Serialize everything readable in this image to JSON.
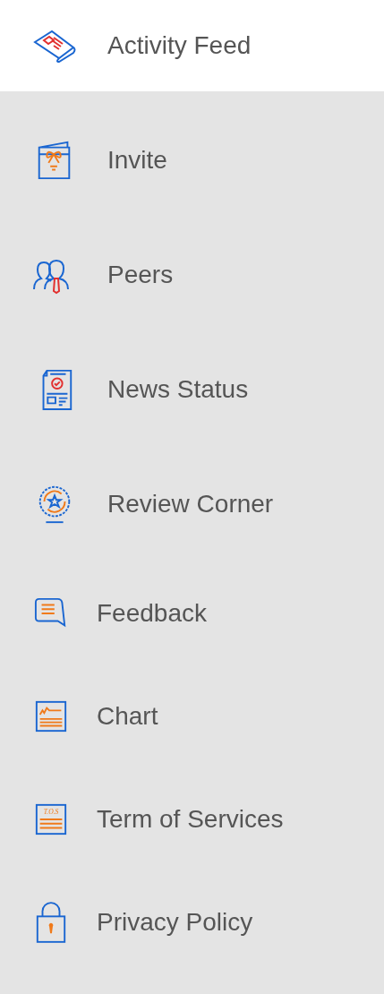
{
  "menu": {
    "items": [
      {
        "label": "Activity Feed",
        "kind": "newspaper",
        "selected": true
      },
      {
        "label": "Invite",
        "kind": "card",
        "selected": false
      },
      {
        "label": "Peers",
        "kind": "people",
        "selected": false
      },
      {
        "label": "News Status",
        "kind": "document",
        "selected": false
      },
      {
        "label": "Review Corner",
        "kind": "badge",
        "selected": false
      }
    ]
  },
  "links": {
    "items": [
      {
        "label": "Feedback",
        "kind": "speech"
      },
      {
        "label": "Chart",
        "kind": "chart"
      },
      {
        "label": "Term of Services",
        "kind": "tos",
        "icon_text": "T.O.S"
      },
      {
        "label": "Privacy Policy",
        "kind": "lock"
      }
    ]
  }
}
